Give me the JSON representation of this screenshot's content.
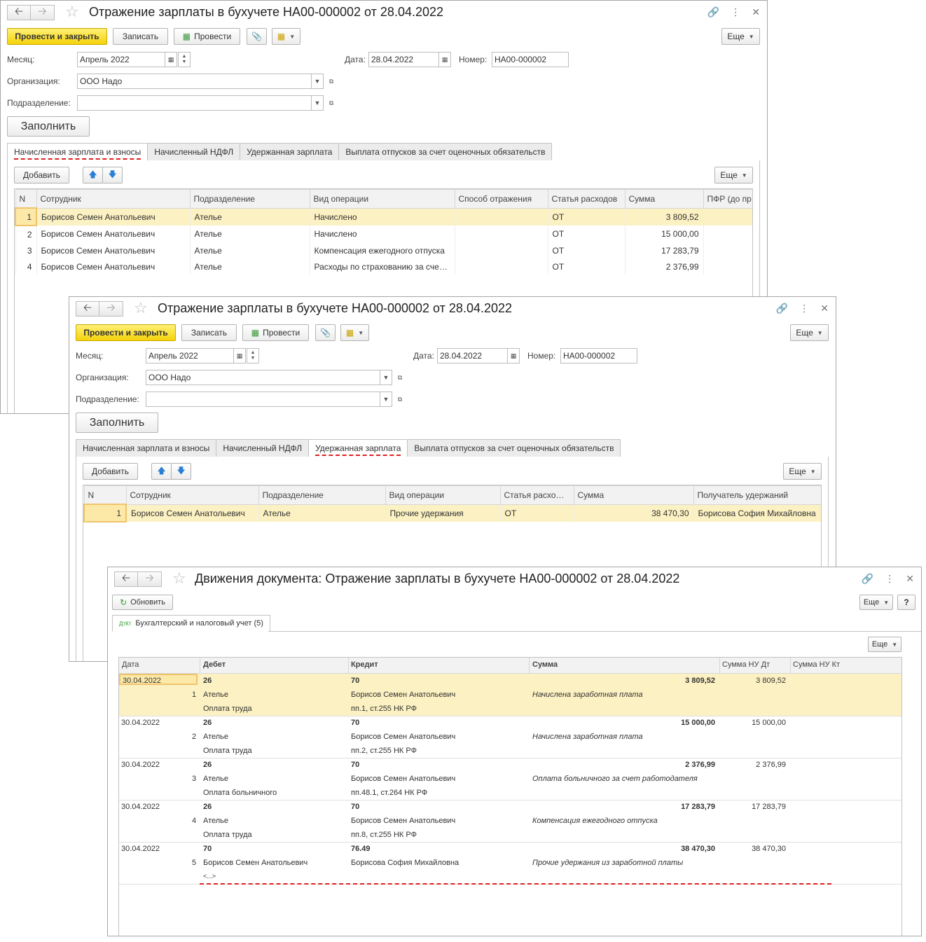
{
  "win1": {
    "title": "Отражение зарплаты в бухучете НА00-000002 от 28.04.2022",
    "btn_post_close": "Провести и закрыть",
    "btn_save": "Записать",
    "btn_post": "Провести",
    "btn_more": "Еще",
    "month_label": "Месяц:",
    "month_value": "Апрель 2022",
    "date_label": "Дата:",
    "date_value": "28.04.2022",
    "number_label": "Номер:",
    "number_value": "НА00-000002",
    "org_label": "Организация:",
    "org_value": "ООО Надо",
    "dept_label": "Подразделение:",
    "dept_value": "",
    "btn_fill": "Заполнить",
    "tabs": [
      "Начисленная зарплата и взносы",
      "Начисленный НДФЛ",
      "Удержанная зарплата",
      "Выплата отпусков за счет оценочных обязательств"
    ],
    "btn_add": "Добавить",
    "btn_more2": "Еще",
    "columns": [
      "N",
      "Сотрудник",
      "Подразделение",
      "Вид операции",
      "Способ отражения",
      "Статья расходов",
      "Сумма",
      "ПФР (до пр"
    ],
    "rows": [
      {
        "n": "1",
        "employee": "Борисов Семен Анатольевич",
        "dept": "Ателье",
        "op": "Начислено",
        "method": "",
        "article": "ОТ",
        "sum": "3 809,52",
        "pfr": ""
      },
      {
        "n": "2",
        "employee": "Борисов Семен Анатольевич",
        "dept": "Ателье",
        "op": "Начислено",
        "method": "",
        "article": "ОТ",
        "sum": "15 000,00",
        "pfr": ""
      },
      {
        "n": "3",
        "employee": "Борисов Семен Анатольевич",
        "dept": "Ателье",
        "op": "Компенсация ежегодного отпуска",
        "method": "",
        "article": "ОТ",
        "sum": "17 283,79",
        "pfr": ""
      },
      {
        "n": "4",
        "employee": "Борисов Семен Анатольевич",
        "dept": "Ателье",
        "op": "Расходы по страхованию за сче…",
        "method": "",
        "article": "ОТ",
        "sum": "2 376,99",
        "pfr": ""
      }
    ]
  },
  "win2": {
    "title": "Отражение зарплаты в бухучете НА00-000002 от 28.04.2022",
    "btn_post_close": "Провести и закрыть",
    "btn_save": "Записать",
    "btn_post": "Провести",
    "btn_more": "Еще",
    "month_label": "Месяц:",
    "month_value": "Апрель 2022",
    "date_label": "Дата:",
    "date_value": "28.04.2022",
    "number_label": "Номер:",
    "number_value": "НА00-000002",
    "org_label": "Организация:",
    "org_value": "ООО Надо",
    "dept_label": "Подразделение:",
    "dept_value": "",
    "btn_fill": "Заполнить",
    "tabs": [
      "Начисленная зарплата и взносы",
      "Начисленный НДФЛ",
      "Удержанная зарплата",
      "Выплата отпусков за счет оценочных обязательств"
    ],
    "btn_add": "Добавить",
    "btn_more2": "Еще",
    "columns": [
      "N",
      "Сотрудник",
      "Подразделение",
      "Вид операции",
      "Статья расхо…",
      "Сумма",
      "Получатель удержаний"
    ],
    "rows": [
      {
        "n": "1",
        "employee": "Борисов Семен Анатольевич",
        "dept": "Ателье",
        "op": "Прочие удержания",
        "article": "ОТ",
        "sum": "38 470,30",
        "recipient": "Борисова София Михайловна"
      }
    ]
  },
  "win3": {
    "title": "Движения документа: Отражение зарплаты в бухучете НА00-000002 от 28.04.2022",
    "btn_refresh": "Обновить",
    "btn_more": "Еще",
    "btn_help": "?",
    "tab_label": "Бухгалтерский и налоговый учет (5)",
    "btn_more2": "Еще",
    "columns": [
      "Дата",
      "Дебет",
      "Кредит",
      "Сумма",
      "Сумма НУ Дт",
      "Сумма НУ Кт"
    ],
    "rows": [
      {
        "date": "30.04.2022",
        "n": "1",
        "debit": "26",
        "debit_sub1": "Ателье",
        "debit_sub2": "Оплата труда",
        "credit": "70",
        "credit_sub1": "Борисов Семен Анатольевич",
        "credit_sub2": "пп.1, ст.255 НК РФ",
        "sum": "3 809,52",
        "content": "Начислена заработная плата",
        "nu_dt": "3 809,52"
      },
      {
        "date": "30.04.2022",
        "n": "2",
        "debit": "26",
        "debit_sub1": "Ателье",
        "debit_sub2": "Оплата труда",
        "credit": "70",
        "credit_sub1": "Борисов Семен Анатольевич",
        "credit_sub2": "пп.2, ст.255 НК РФ",
        "sum": "15 000,00",
        "content": "Начислена заработная плата",
        "nu_dt": "15 000,00"
      },
      {
        "date": "30.04.2022",
        "n": "3",
        "debit": "26",
        "debit_sub1": "Ателье",
        "debit_sub2": "Оплата больничного",
        "credit": "70",
        "credit_sub1": "Борисов Семен Анатольевич",
        "credit_sub2": "пп.48.1, ст.264 НК РФ",
        "sum": "2 376,99",
        "content": "Оплата больничного за счет работодателя",
        "nu_dt": "2 376,99"
      },
      {
        "date": "30.04.2022",
        "n": "4",
        "debit": "26",
        "debit_sub1": "Ателье",
        "debit_sub2": "Оплата труда",
        "credit": "70",
        "credit_sub1": "Борисов Семен Анатольевич",
        "credit_sub2": "пп.8, ст.255 НК РФ",
        "sum": "17 283,79",
        "content": "Компенсация ежегодного отпуска",
        "nu_dt": "17 283,79"
      },
      {
        "date": "30.04.2022",
        "n": "5",
        "debit": "70",
        "debit_sub1": "Борисов Семен Анатольевич",
        "debit_sub2": "<...>",
        "credit": "76.49",
        "credit_sub1": "Борисова София Михайловна",
        "credit_sub2": "",
        "sum": "38 470,30",
        "content": "Прочие удержания из заработной платы",
        "nu_dt": "38 470,30"
      }
    ]
  }
}
